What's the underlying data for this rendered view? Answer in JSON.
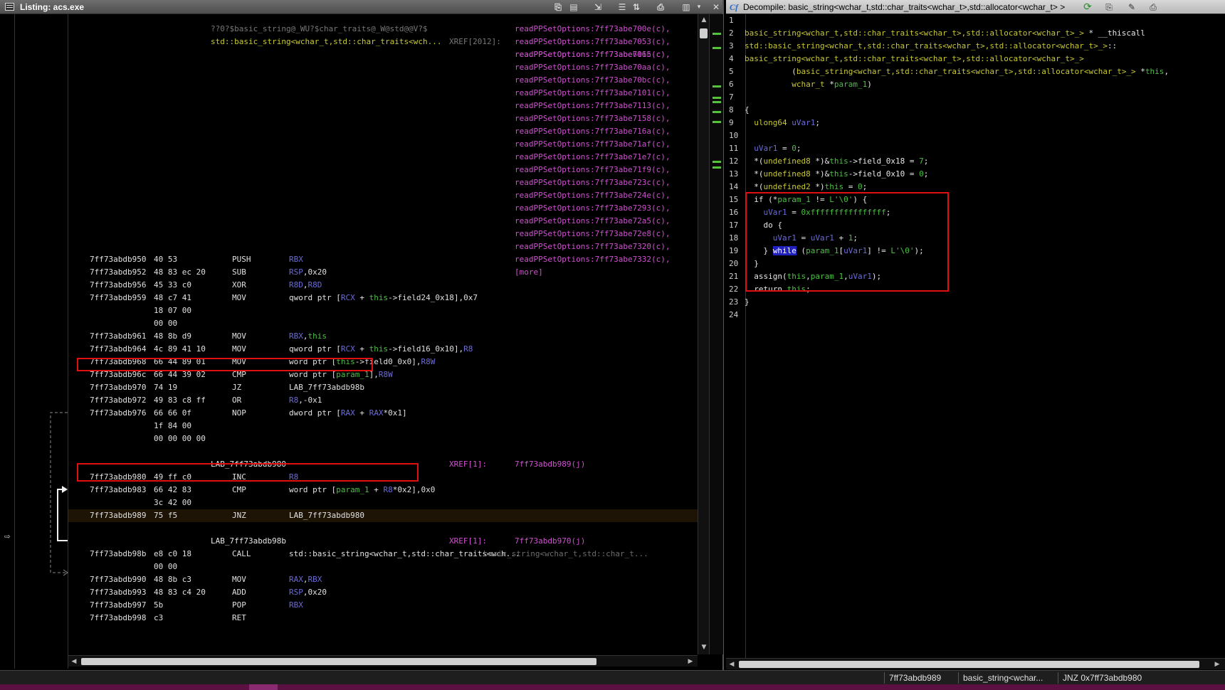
{
  "listing": {
    "title": "Listing: acs.exe",
    "top_label_1": "??0?$basic_string@_WU?$char_traits@_W@std@@V?$",
    "top_label_1_xref": "XREF[2012]:",
    "top_label_1_target": "readPPSetOptions:7ff73abe611c(c),",
    "top_label_2": "std::basic_string<wchar_t,std::char_traits<wch...",
    "xrefs": [
      "readPPSetOptions:7ff73abe700e(c),",
      "readPPSetOptions:7ff73abe7053(c),",
      "readPPSetOptions:7ff73abe7065(c),",
      "readPPSetOptions:7ff73abe70aa(c),",
      "readPPSetOptions:7ff73abe70bc(c),",
      "readPPSetOptions:7ff73abe7101(c),",
      "readPPSetOptions:7ff73abe7113(c),",
      "readPPSetOptions:7ff73abe7158(c),",
      "readPPSetOptions:7ff73abe716a(c),",
      "readPPSetOptions:7ff73abe71af(c),",
      "readPPSetOptions:7ff73abe71e7(c),",
      "readPPSetOptions:7ff73abe71f9(c),",
      "readPPSetOptions:7ff73abe723c(c),",
      "readPPSetOptions:7ff73abe724e(c),",
      "readPPSetOptions:7ff73abe7293(c),",
      "readPPSetOptions:7ff73abe72a5(c),",
      "readPPSetOptions:7ff73abe72e8(c),",
      "readPPSetOptions:7ff73abe7320(c),",
      "readPPSetOptions:7ff73abe7332(c),",
      "[more]"
    ],
    "instructions": [
      {
        "addr": "7ff73abdb950",
        "bytes": "40 53",
        "mnem": "PUSH",
        "ops": "RBX"
      },
      {
        "addr": "7ff73abdb952",
        "bytes": "48 83 ec 20",
        "mnem": "SUB",
        "ops": "RSP,0x20"
      },
      {
        "addr": "7ff73abdb956",
        "bytes": "45 33 c0",
        "mnem": "XOR",
        "ops": "R8D,R8D"
      },
      {
        "addr": "7ff73abdb959",
        "bytes": "48 c7 41",
        "mnem": "MOV",
        "ops": "qword ptr [RCX + this->field24_0x18],0x7"
      },
      {
        "addr": "",
        "bytes": "18 07 00",
        "mnem": "",
        "ops": ""
      },
      {
        "addr": "",
        "bytes": "00 00",
        "mnem": "",
        "ops": ""
      },
      {
        "addr": "7ff73abdb961",
        "bytes": "48 8b d9",
        "mnem": "MOV",
        "ops": "RBX,this"
      },
      {
        "addr": "7ff73abdb964",
        "bytes": "4c 89 41 10",
        "mnem": "MOV",
        "ops": "qword ptr [RCX + this->field16_0x10],R8"
      },
      {
        "addr": "7ff73abdb968",
        "bytes": "66 44 89 01",
        "mnem": "MOV",
        "ops": "word ptr [this->field0_0x0],R8W"
      },
      {
        "addr": "7ff73abdb96c",
        "bytes": "66 44 39 02",
        "mnem": "CMP",
        "ops": "word ptr [param_1],R8W"
      },
      {
        "addr": "7ff73abdb970",
        "bytes": "74 19",
        "mnem": "JZ",
        "ops": "LAB_7ff73abdb98b"
      },
      {
        "addr": "7ff73abdb972",
        "bytes": "49 83 c8 ff",
        "mnem": "OR",
        "ops": "R8,-0x1"
      },
      {
        "addr": "7ff73abdb976",
        "bytes": "66 66 0f",
        "mnem": "NOP",
        "ops": "dword ptr [RAX + RAX*0x1]"
      },
      {
        "addr": "",
        "bytes": "1f 84 00",
        "mnem": "",
        "ops": ""
      },
      {
        "addr": "",
        "bytes": "00 00 00 00",
        "mnem": "",
        "ops": ""
      }
    ],
    "lab1": {
      "name": "LAB_7ff73abdb980",
      "xref": "XREF[1]:",
      "target": "7ff73abdb989(j)"
    },
    "loop": [
      {
        "addr": "7ff73abdb980",
        "bytes": "49 ff c0",
        "mnem": "INC",
        "ops": "R8"
      },
      {
        "addr": "7ff73abdb983",
        "bytes": "66 42 83",
        "mnem": "CMP",
        "ops": "word ptr [param_1 + R8*0x2],0x0"
      },
      {
        "addr": "",
        "bytes": "3c 42 00",
        "mnem": "",
        "ops": ""
      },
      {
        "addr": "7ff73abdb989",
        "bytes": "75 f5",
        "mnem": "JNZ",
        "ops": "LAB_7ff73abdb980"
      }
    ],
    "lab2": {
      "name": "LAB_7ff73abdb98b",
      "xref": "XREF[1]:",
      "target": "7ff73abdb970(j)"
    },
    "tail": [
      {
        "addr": "7ff73abdb98b",
        "bytes": "e8 c0 18",
        "mnem": "CALL",
        "ops": "std::basic_string<wchar_t,std::char_traits<wch...",
        "extra": "basic_string<wchar_t,std::char_t..."
      },
      {
        "addr": "",
        "bytes": "00 00",
        "mnem": "",
        "ops": ""
      },
      {
        "addr": "7ff73abdb990",
        "bytes": "48 8b c3",
        "mnem": "MOV",
        "ops": "RAX,RBX"
      },
      {
        "addr": "7ff73abdb993",
        "bytes": "48 83 c4 20",
        "mnem": "ADD",
        "ops": "RSP,0x20"
      },
      {
        "addr": "7ff73abdb997",
        "bytes": "5b",
        "mnem": "POP",
        "ops": "RBX"
      },
      {
        "addr": "7ff73abdb998",
        "bytes": "c3",
        "mnem": "RET",
        "ops": ""
      }
    ]
  },
  "decompile": {
    "title": "Decompile: basic_string<wchar_t,std::char_traits<wchar_t>,std::allocator<wchar_t> >",
    "line_numbers": [
      "1",
      "2",
      "3",
      "4",
      "5",
      "6",
      "7",
      "8",
      "9",
      "10",
      "11",
      "12",
      "13",
      "14",
      "15",
      "16",
      "17",
      "18",
      "19",
      "20",
      "21",
      "22",
      "23",
      "24"
    ],
    "lines": {
      "l2a": "basic_string<wchar_t,std::char_traits<wchar_t>,std::allocator<wchar_t>_>",
      "l2b": " * __thiscall",
      "l3a": "std::basic_string<wchar_t,std::char_traits<wchar_t>,std::allocator<wchar_t>_>",
      "l3b": "::",
      "l4": "basic_string<wchar_t,std::char_traits<wchar_t>,std::allocator<wchar_t>_>",
      "l5a": "          (",
      "l5b": "basic_string<wchar_t,std::char_traits<wchar_t>,std::allocator<wchar_t>_>",
      "l5c": " *",
      "l5d": "this",
      "l5e": ",",
      "l6a": "          ",
      "l6b": "wchar_t",
      "l6c": " *",
      "l6d": "param_1",
      "l6e": ")",
      "l8": "{",
      "l9a": "  ",
      "l9b": "ulong64",
      "l9c": " ",
      "l9d": "uVar1",
      "l9e": ";",
      "l11a": "  ",
      "l11b": "uVar1",
      "l11c": " = ",
      "l11d": "0",
      "l11e": ";",
      "l12a": "  *(",
      "l12b": "undefined8",
      "l12c": " *)&",
      "l12d": "this",
      "l12e": "->field_0x18 = ",
      "l12f": "7",
      "l12g": ";",
      "l13a": "  *(",
      "l13b": "undefined8",
      "l13c": " *)&",
      "l13d": "this",
      "l13e": "->field_0x10 = ",
      "l13f": "0",
      "l13g": ";",
      "l14a": "  *(",
      "l14b": "undefined2",
      "l14c": " *)",
      "l14d": "this",
      "l14e": " = ",
      "l14f": "0",
      "l14g": ";",
      "l15a": "  if (*",
      "l15b": "param_1",
      "l15c": " != ",
      "l15d": "L'\\0'",
      "l15e": ") {",
      "l16a": "    ",
      "l16b": "uVar1",
      "l16c": " = ",
      "l16d": "0xffffffffffffffff",
      "l16e": ";",
      "l17": "    do {",
      "l18a": "      ",
      "l18b": "uVar1",
      "l18c": " = ",
      "l18d": "uVar1",
      "l18e": " + ",
      "l18f": "1",
      "l18g": ";",
      "l19a": "    } ",
      "l19b": "while",
      "l19c": " (",
      "l19d": "param_1",
      "l19e": "[",
      "l19f": "uVar1",
      "l19g": "] != ",
      "l19h": "L'\\0'",
      "l19i": ");",
      "l20": "  }",
      "l21a": "  ",
      "l21b": "assign",
      "l21c": "(",
      "l21d": "this",
      "l21e": ",",
      "l21f": "param_1",
      "l21g": ",",
      "l21h": "uVar1",
      "l21i": ");",
      "l22a": "  return ",
      "l22b": "this",
      "l22c": ";",
      "l23": "}"
    }
  },
  "status": {
    "address": "7ff73abdb989",
    "function": "basic_string<wchar...",
    "instruction": "JNZ 0x7ff73abdb980"
  }
}
